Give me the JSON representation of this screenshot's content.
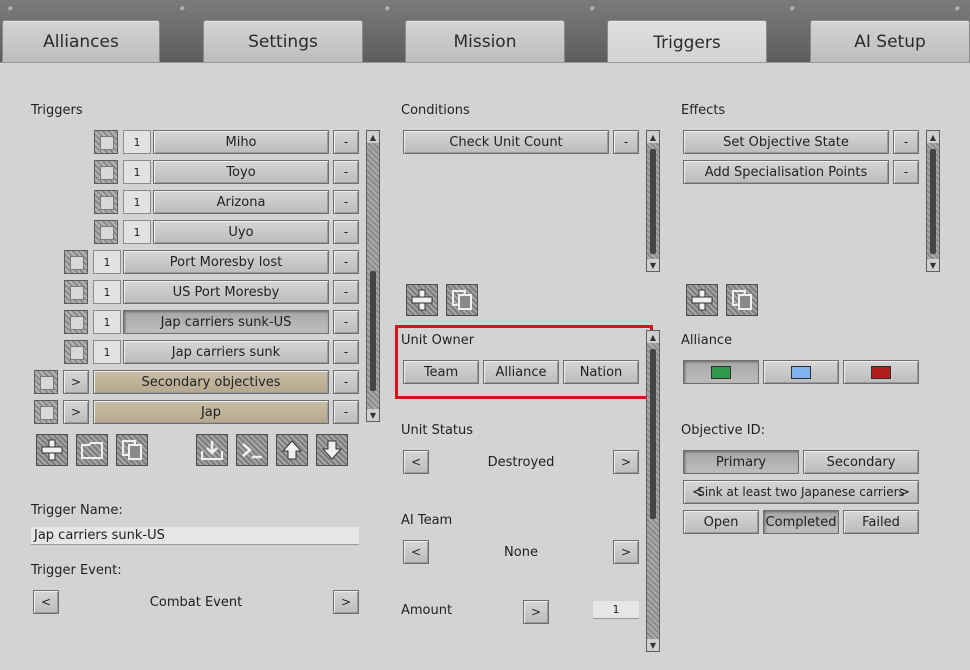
{
  "tabs": [
    {
      "label": "Alliances"
    },
    {
      "label": "Settings"
    },
    {
      "label": "Mission"
    },
    {
      "label": "Triggers"
    },
    {
      "label": "AI Setup"
    }
  ],
  "triggers": {
    "title": "Triggers",
    "items": [
      {
        "num": "1",
        "label": "Miho"
      },
      {
        "num": "1",
        "label": "Toyo"
      },
      {
        "num": "1",
        "label": "Arizona"
      },
      {
        "num": "1",
        "label": "Uyo"
      },
      {
        "num": "1",
        "label": "Port Moresby lost"
      },
      {
        "num": "1",
        "label": "US Port Moresby"
      },
      {
        "num": "1",
        "label": "Jap carriers sunk-US"
      },
      {
        "num": "1",
        "label": "Jap carriers sunk"
      },
      {
        "expand": ">",
        "label": "Secondary objectives"
      },
      {
        "expand": ">",
        "label": "Jap"
      }
    ],
    "remove_label": "-",
    "trigger_name_label": "Trigger Name:",
    "trigger_name_value": "Jap carriers sunk-US",
    "trigger_event_label": "Trigger Event:",
    "trigger_event_value": "Combat Event",
    "prev": "<",
    "next": ">"
  },
  "conditions": {
    "title": "Conditions",
    "items": [
      {
        "label": "Check Unit Count"
      }
    ],
    "remove_label": "-",
    "unit_owner_label": "Unit Owner",
    "owner_options": [
      "Team",
      "Alliance",
      "Nation"
    ],
    "unit_status_label": "Unit Status",
    "unit_status_value": "Destroyed",
    "ai_team_label": "AI Team",
    "ai_team_value": "None",
    "amount_label": "Amount",
    "amount_value": "1",
    "prev": "<",
    "next": ">"
  },
  "effects": {
    "title": "Effects",
    "items": [
      {
        "label": "Set Objective State"
      },
      {
        "label": "Add Specialisation Points"
      }
    ],
    "remove_label": "-",
    "alliance_label": "Alliance",
    "alliance_colors": [
      "#2e9a4a",
      "#7fb2f0",
      "#b01e1e"
    ],
    "objective_id_label": "Objective ID:",
    "objective_types": [
      "Primary",
      "Secondary"
    ],
    "objective_name": "Sink at least two Japanese carriers",
    "obj_prev": "<",
    "obj_next": ">",
    "states": [
      "Open",
      "Completed",
      "Failed"
    ]
  }
}
